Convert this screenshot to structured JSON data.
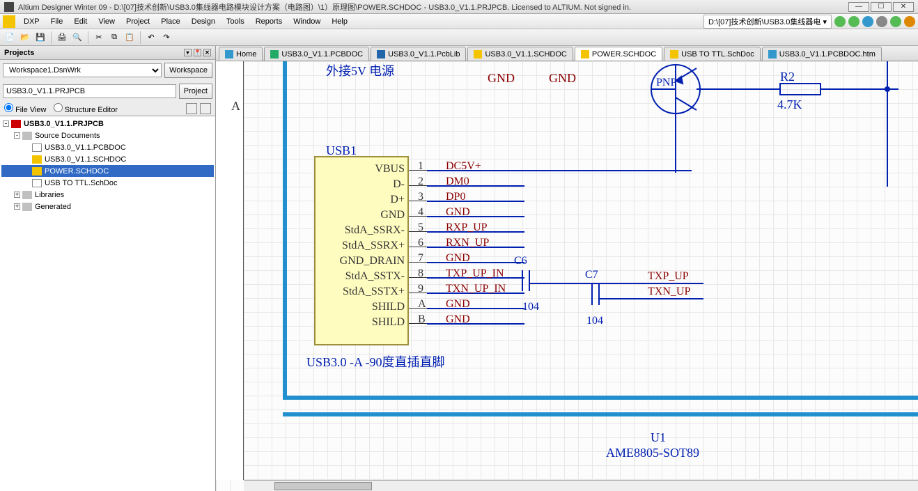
{
  "title": "Altium Designer Winter 09 - D:\\[07]技术创新\\USB3.0集线器电路模块设计方案（电路图）\\1）原理图\\POWER.SCHDOC - USB3.0_V1.1.PRJPCB. Licensed to ALTIUM. Not signed in.",
  "menu": {
    "dxp": "DXP",
    "file": "File",
    "edit": "Edit",
    "view": "View",
    "project": "Project",
    "place": "Place",
    "design": "Design",
    "tools": "Tools",
    "reports": "Reports",
    "window": "Window",
    "help": "Help"
  },
  "pathbox": "D:\\[07]技术创新\\USB3.0集线器电 ▾",
  "projects": {
    "title": "Projects",
    "workspace_value": "Workspace1.DsnWrk",
    "workspace_btn": "Workspace",
    "project_value": "USB3.0_V1.1.PRJPCB",
    "project_btn": "Project",
    "view_file": "File View",
    "view_struct": "Structure Editor",
    "tree": {
      "root": "USB3.0_V1.1.PRJPCB",
      "src": "Source Documents",
      "pcb": "USB3.0_V1.1.PCBDOC",
      "sch": "USB3.0_V1.1.SCHDOC",
      "pwr": "POWER.SCHDOC",
      "ttl": "USB TO TTL.SchDoc",
      "lib": "Libraries",
      "gen": "Generated"
    }
  },
  "tabs": {
    "home": "Home",
    "t1": "USB3.0_V1.1.PCBDOC",
    "t2": "USB3.0_V1.1.PcbLib",
    "t3": "USB3.0_V1.1.SCHDOC",
    "t4": "POWER.SCHDOC",
    "t5": "USB TO TTL.SchDoc",
    "t6": "USB3.0_V1.1.PCBDOC.htm"
  },
  "schematic": {
    "ruler_a": "A",
    "top_text": "外接5V 电源",
    "gnd": "GND",
    "usb_label": "USB1",
    "usb_footprint": "USB3.0 -A -90度直插直脚",
    "pins": [
      "VBUS",
      "D-",
      "D+",
      "GND",
      "StdA_SSRX-",
      "StdA_SSRX+",
      "GND_DRAIN",
      "StdA_SSTX-",
      "StdA_SSTX+",
      "SHILD",
      "SHILD"
    ],
    "pin_nums": [
      "1",
      "2",
      "3",
      "4",
      "5",
      "6",
      "7",
      "8",
      "9",
      "A",
      "B"
    ],
    "nets": {
      "n1": "DC5V+",
      "n2": "DM0",
      "n3": "DP0",
      "n4": "GND",
      "n5": "RXP_UP",
      "n6": "RXN_UP",
      "n7": "GND",
      "n8": "TXP_UP_IN",
      "n9": "TXN_UP_IN",
      "n10": "GND",
      "n11": "GND",
      "txp": "TXP_UP",
      "txn": "TXN_UP"
    },
    "c6": "C6",
    "c6v": "104",
    "c7": "C7",
    "c7v": "104",
    "pnp": "PNP",
    "r2": "R2",
    "r2v": "4.7K",
    "u1": "U1",
    "u1v": "AME8805-SOT89"
  }
}
